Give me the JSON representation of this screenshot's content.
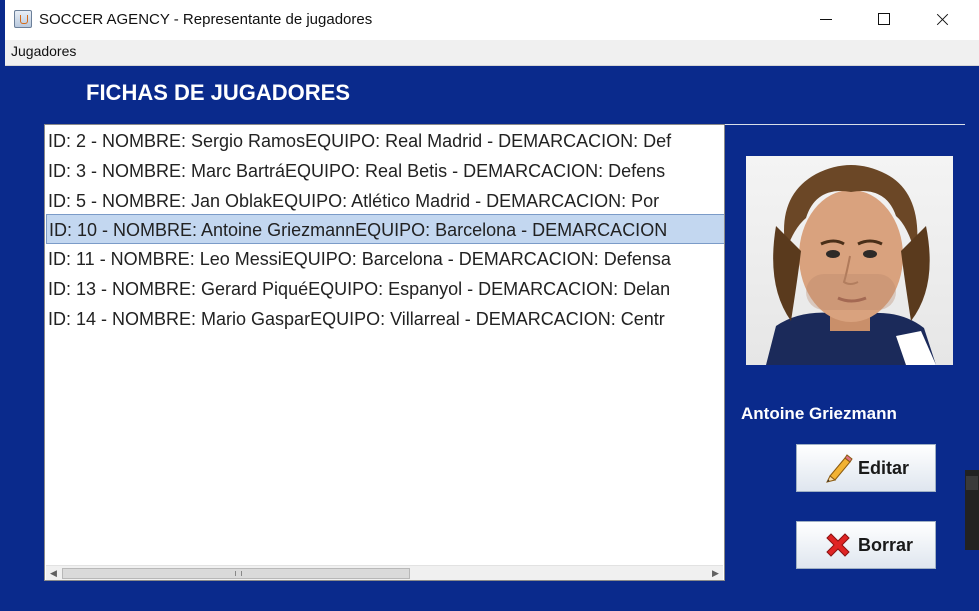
{
  "window": {
    "title": "SOCCER AGENCY - Representante de jugadores",
    "app_icon": "java-icon",
    "controls": [
      "minimize-icon",
      "maximize-icon",
      "close-icon"
    ]
  },
  "menu": {
    "items": [
      "Jugadores"
    ]
  },
  "panel": {
    "heading": "FICHAS DE JUGADORES",
    "background": "#0a2a8c"
  },
  "players": {
    "rows": [
      "ID: 2 - NOMBRE: Sergio RamosEQUIPO: Real Madrid - DEMARCACION: Def",
      "ID: 3 - NOMBRE: Marc BartráEQUIPO: Real Betis - DEMARCACION: Defens",
      "ID: 5 - NOMBRE: Jan OblakEQUIPO: Atlético Madrid - DEMARCACION: Por",
      "ID: 10 - NOMBRE: Antoine GriezmannEQUIPO: Barcelona - DEMARCACION",
      "ID: 11 - NOMBRE: Leo MessiEQUIPO: Barcelona - DEMARCACION: Defensa",
      "ID: 13 - NOMBRE: Gerard PiquéEQUIPO: Espanyol - DEMARCACION: Delan",
      "ID: 14 - NOMBRE: Mario GasparEQUIPO: Villarreal - DEMARCACION: Centr"
    ],
    "selected_index": 3,
    "selection_color": "#c3d7f0"
  },
  "detail": {
    "photo": "player-photo",
    "name": "Antoine Griezmann",
    "edit_label": "Editar",
    "edit_icon": "pencil-icon",
    "delete_label": "Borrar",
    "delete_icon": "red-x-icon"
  }
}
